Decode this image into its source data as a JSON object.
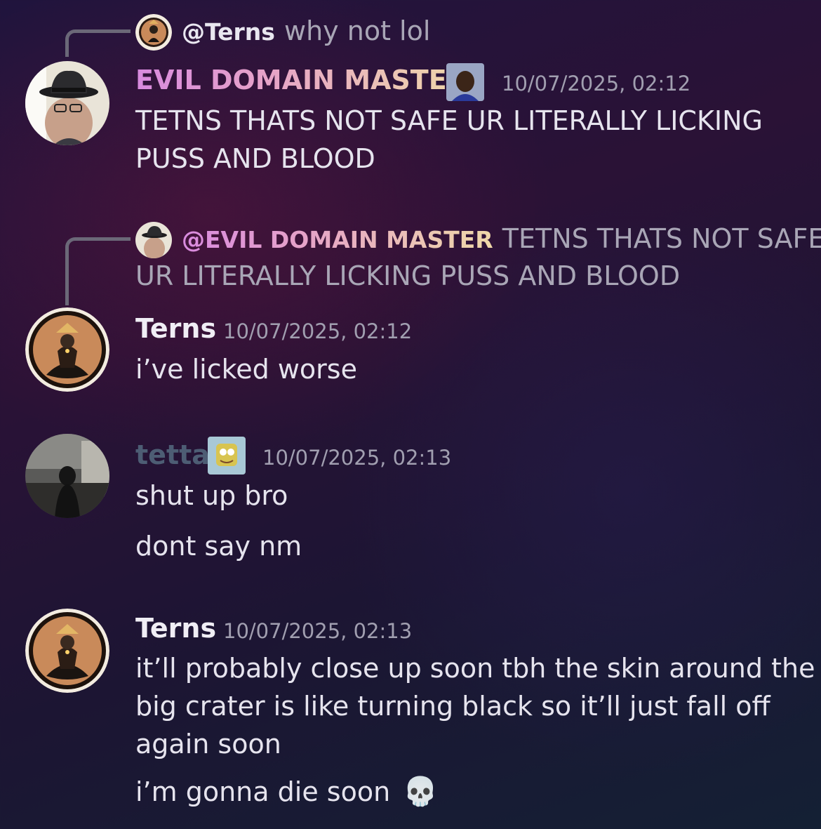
{
  "messages": [
    {
      "reply": {
        "mention": "@Terns",
        "text": "why not lol"
      },
      "author": "EVIL DOMAIN MASTER",
      "timestamp": "10/07/2025, 02:12",
      "lines": [
        "TETNS THATS NOT SAFE UR LITERALLY LICKING",
        "PUSS AND BLOOD"
      ]
    },
    {
      "reply": {
        "mention": "@EVIL DOMAIN MASTER",
        "text_line1": "TETNS THATS NOT SAFE",
        "text_line2": "UR LITERALLY LICKING PUSS AND BLOOD"
      },
      "author": "Terns",
      "timestamp": "10/07/2025, 02:12",
      "lines": [
        "i’ve licked worse"
      ]
    },
    {
      "author": "tetta",
      "timestamp": "10/07/2025, 02:13",
      "lines": [
        "shut up bro",
        "dont say nm"
      ]
    },
    {
      "author": "Terns",
      "timestamp": "10/07/2025, 02:13",
      "lines": [
        "it’ll probably close up soon tbh the skin around the",
        "big crater is like turning black so it’ll just fall off",
        "again soon",
        "i’m gonna die soon"
      ]
    }
  ],
  "emoji": {
    "skull": "💀"
  },
  "colors": {
    "evil_name_gradient": [
      "#d88adf",
      "#efd9a8"
    ],
    "terns_name": "#f0eef5",
    "tetta_name": "#4d5d74",
    "timestamp": "#a19fb0",
    "reply_line": "#6b6878"
  }
}
